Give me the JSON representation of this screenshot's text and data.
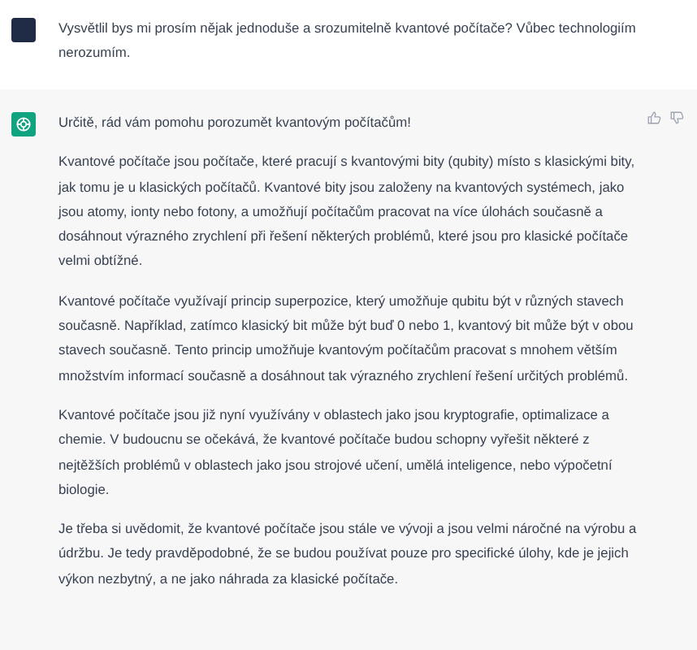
{
  "messages": [
    {
      "kind": "user",
      "paragraphs": [
        "Vysvětlil bys mi prosím nějak jednoduše a srozumitelně kvantové počítače? Vůbec technologiím nerozumím."
      ]
    },
    {
      "kind": "assistant",
      "paragraphs": [
        "Určitě, rád vám pomohu porozumět kvantovým počítačům!",
        "Kvantové počítače jsou počítače, které pracují s kvantovými bity (qubity) místo s klasickými bity, jak tomu je u klasických počítačů. Kvantové bity jsou založeny na kvantových systémech, jako jsou atomy, ionty nebo fotony, a umožňují počítačům pracovat na více úlohách současně a dosáhnout výrazného zrychlení při řešení některých problémů, které jsou pro klasické počítače velmi obtížné.",
        "Kvantové počítače využívají princip superpozice, který umožňuje qubitu být v různých stavech současně. Například, zatímco klasický bit může být buď 0 nebo 1, kvantový bit může být v obou stavech současně. Tento princip umožňuje kvantovým počítačům pracovat s mnohem větším množstvím informací současně a dosáhnout tak výrazného zrychlení řešení určitých problémů.",
        "Kvantové počítače jsou již nyní využívány v oblastech jako jsou kryptografie, optimalizace a chemie. V budoucnu se očekává, že kvantové počítače budou schopny vyřešit některé z nejtěžších problémů v oblastech jako jsou strojové učení, umělá inteligence, nebo výpočetní biologie.",
        "Je třeba si uvědomit, že kvantové počítače jsou stále ve vývoji a jsou velmi náročné na výrobu a údržbu. Je tedy pravděpodobné, že se budou používat pouze pro specifické úlohy, kde je jejich výkon nezbytný, a ne jako náhrada za klasické počítače."
      ]
    }
  ]
}
